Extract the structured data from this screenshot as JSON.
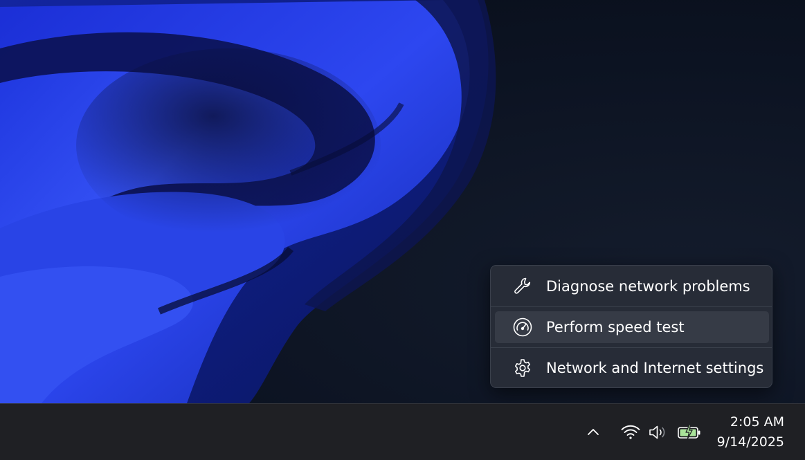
{
  "context_menu": {
    "items": [
      {
        "label": "Diagnose network problems",
        "icon": "wrench-icon"
      },
      {
        "label": "Perform speed test",
        "icon": "speedometer-icon"
      },
      {
        "label": "Network and Internet settings",
        "icon": "gear-icon"
      }
    ],
    "hovered_index": 1
  },
  "taskbar": {
    "tray_icons": [
      "chevron-up-icon",
      "wifi-icon",
      "volume-icon",
      "battery-charging-icon"
    ],
    "clock": {
      "time": "2:05 AM",
      "date": "9/14/2025"
    }
  },
  "colors": {
    "menu_background": "#282d38",
    "menu_hover": "#363b46",
    "taskbar_background": "#1f2024",
    "battery_accent": "#a9e39a",
    "wallpaper_blue": "#2a44e8"
  }
}
